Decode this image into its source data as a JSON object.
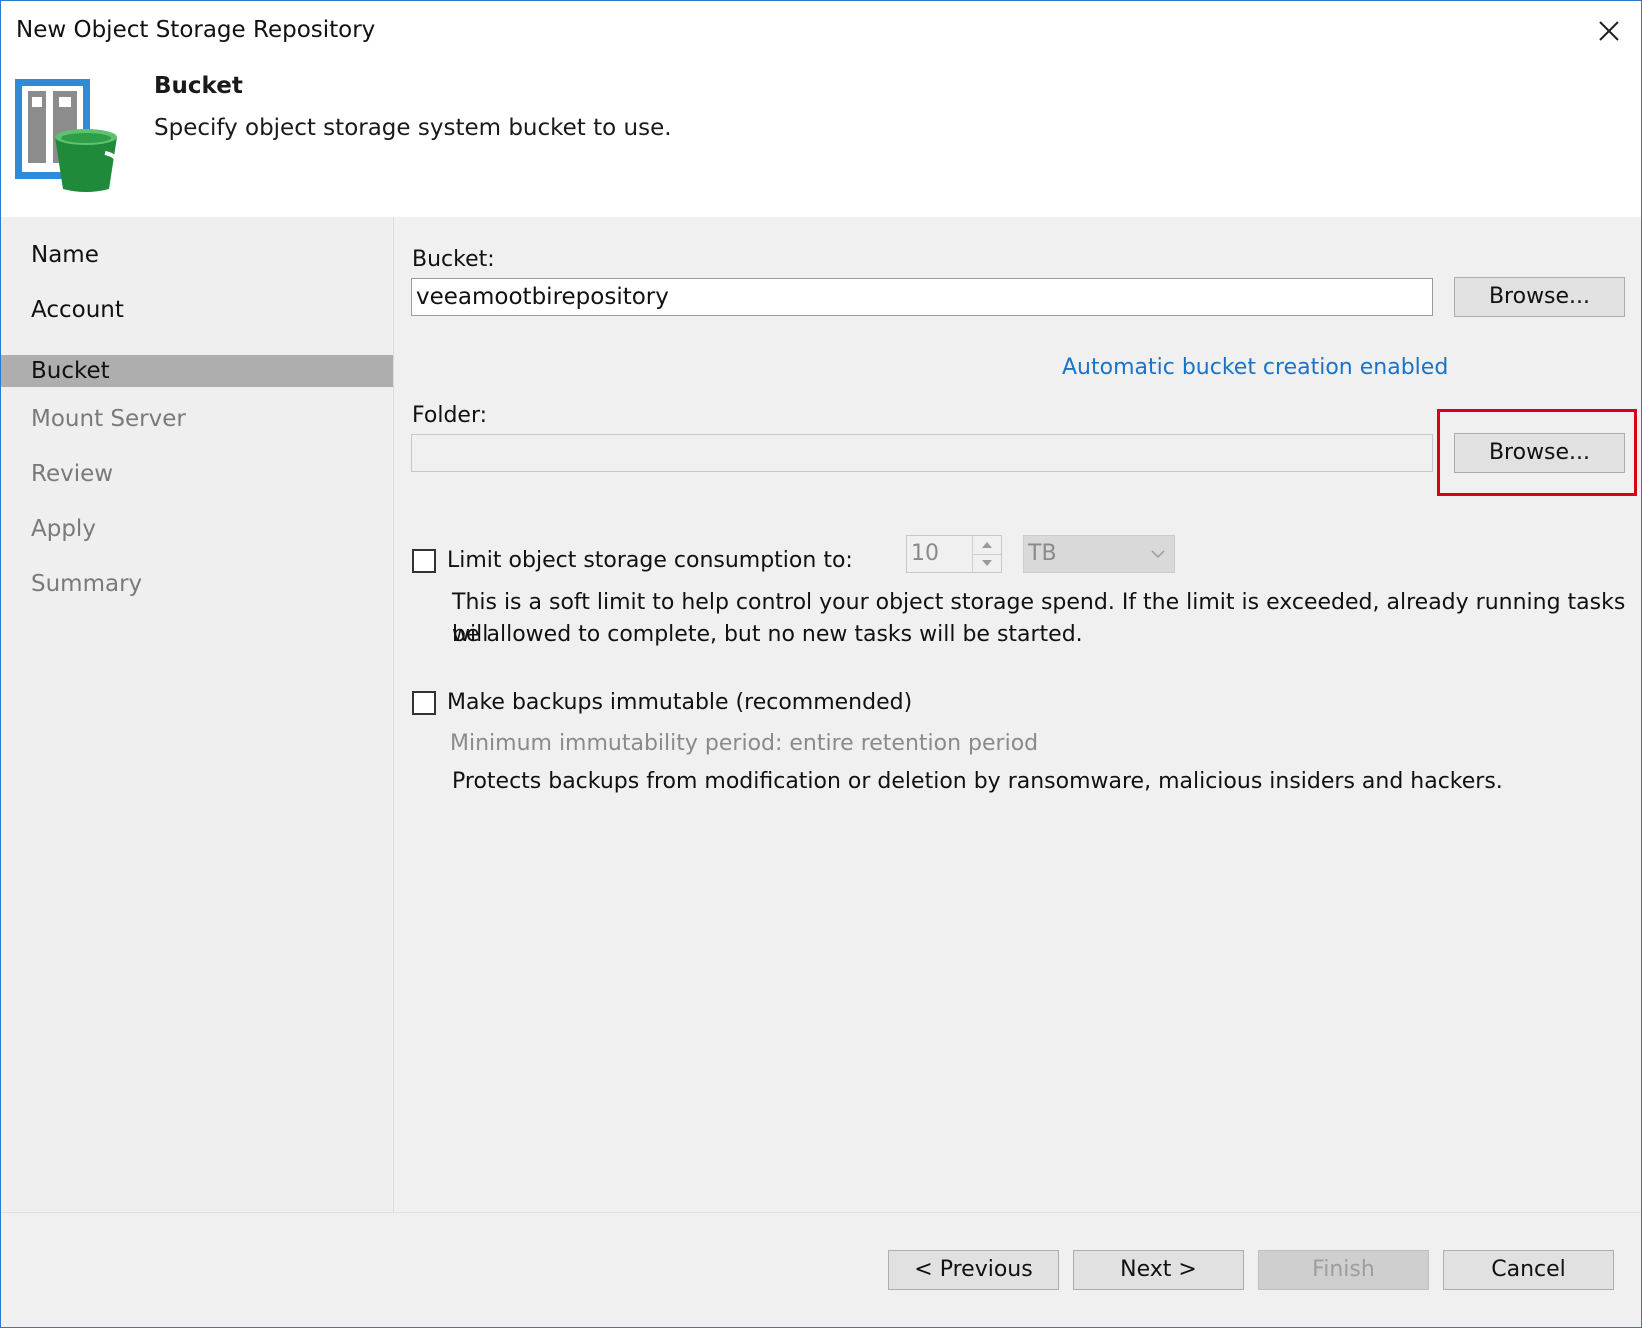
{
  "window": {
    "title": "New Object Storage Repository",
    "close_icon": "close-icon"
  },
  "header": {
    "icon": "object-storage-bucket-icon",
    "step_title": "Bucket",
    "step_description": "Specify object storage system bucket to use."
  },
  "nav": {
    "items": [
      {
        "label": "Name",
        "state": "done"
      },
      {
        "label": "Account",
        "state": "done"
      },
      {
        "label": "Bucket",
        "state": "active"
      },
      {
        "label": "Mount Server",
        "state": "disabled"
      },
      {
        "label": "Review",
        "state": "disabled"
      },
      {
        "label": "Apply",
        "state": "disabled"
      },
      {
        "label": "Summary",
        "state": "disabled"
      }
    ]
  },
  "bucket": {
    "label": "Bucket:",
    "value": "veeamootbirepository",
    "browse_label": "Browse...",
    "auto_creation_link": "Automatic bucket creation enabled"
  },
  "folder": {
    "label": "Folder:",
    "value": "",
    "browse_label": "Browse..."
  },
  "limit": {
    "checked": false,
    "label": "Limit object storage consumption to:",
    "value": "10",
    "unit": "TB",
    "description_line1": "This is a soft limit to help control your object storage spend. If the limit is exceeded, already running tasks will",
    "description_line2": "be allowed to complete, but no new tasks will be started."
  },
  "immutable": {
    "checked": false,
    "label": "Make backups immutable (recommended)",
    "min_period": "Minimum immutability period: entire retention period",
    "description": "Protects backups from modification or deletion by ransomware, malicious insiders and hackers."
  },
  "footer": {
    "previous_label": "< Previous",
    "next_label": "Next >",
    "finish_label": "Finish",
    "finish_enabled": false,
    "cancel_label": "Cancel"
  },
  "colors": {
    "accent": "#1a73c7",
    "highlight": "#d9001b",
    "nav_active": "#aeaeae",
    "window_border": "#2b79d4"
  }
}
